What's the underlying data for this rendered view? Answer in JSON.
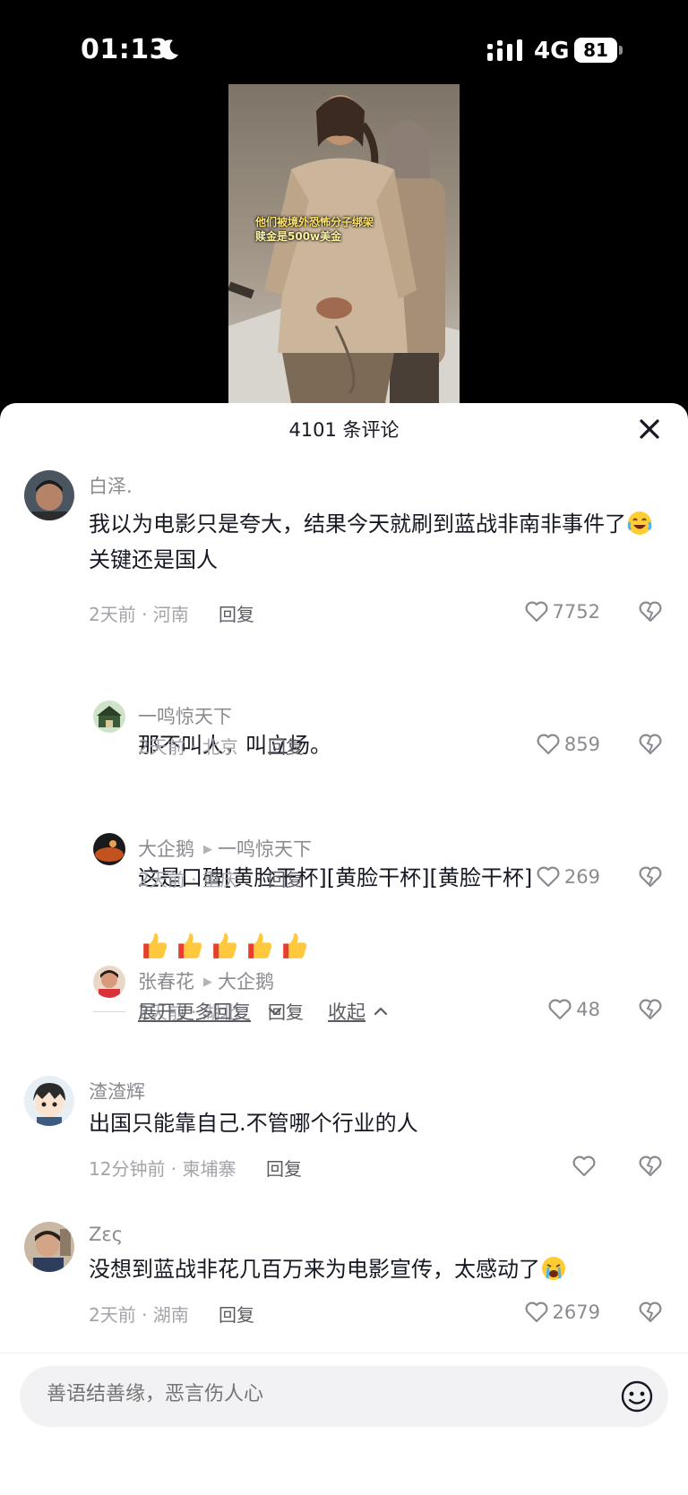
{
  "status_bar": {
    "time": "01:13",
    "network": "4G",
    "battery": "81"
  },
  "video": {
    "caption_line1": "他们被境外恐怖分子绑架",
    "caption_line2": "赎金是500w美金"
  },
  "sheet": {
    "title": "4101 条评论"
  },
  "comments": [
    {
      "username": "白泽.",
      "text_part1": "我以为电影只是夸大，结果今天就刷到蓝战非南非事件了",
      "text_part2": "关键还是国人",
      "meta": "2天前 · 河南",
      "reply_label": "回复",
      "likes": "7752",
      "replies": [
        {
          "username": "一鸣惊天下",
          "text": "那不叫人，叫立场。",
          "meta": "2天前 · 北京",
          "reply_label": "回复",
          "likes": "859"
        },
        {
          "username": "大企鹅",
          "reply_to": "一鸣惊天下",
          "text": "这是口碑[黄脸干杯][黄脸干杯][黄脸干杯]",
          "meta": "2天前 · 重庆",
          "reply_label": "回复",
          "likes": "269"
        },
        {
          "username": "张春花",
          "reply_to": "大企鹅",
          "text": "",
          "meta": "2天前 · 湖北",
          "reply_label": "回复",
          "likes": "48"
        }
      ],
      "expand_label": "展开更多回复",
      "collapse_label": "收起"
    },
    {
      "username": "渣渣辉",
      "text": "出国只能靠自己.不管哪个行业的人",
      "meta": "12分钟前 · 柬埔寨",
      "reply_label": "回复",
      "likes": ""
    },
    {
      "username": "Ζες",
      "text": "没想到蓝战非花几百万来为电影宣传，太感动了",
      "meta": "2天前 · 湖南",
      "reply_label": "回复",
      "likes": "2679"
    }
  ],
  "input": {
    "placeholder": "善语结善缘，恶言伤人心"
  },
  "icons": {
    "moon": "moon-icon",
    "signal": "signal-icon",
    "close": "close-icon",
    "heart": "heart-outline-icon",
    "dislike": "broken-heart-icon",
    "emoji": "smiley-icon",
    "thumbs": "thumbs-up-emoji",
    "laugh_cry": "laugh-cry-emoji",
    "cry": "crying-emoji",
    "chevron_down": "chevron-down-icon",
    "chevron_up": "chevron-up-icon"
  }
}
